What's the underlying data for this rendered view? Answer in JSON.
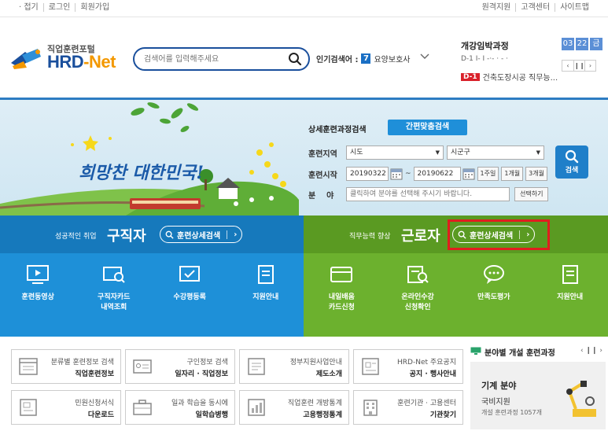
{
  "util": {
    "left": [
      "· 접기",
      "로그인",
      "회원가입"
    ],
    "right": [
      "원격지원",
      "고객센터",
      "사이트맵"
    ]
  },
  "logo": {
    "sub": "직업훈련포털",
    "main_a": "HRD",
    "main_b": "-Net"
  },
  "search": {
    "placeholder": "검색어를 입력해주세요"
  },
  "popular": {
    "label": "인기검색어 :",
    "rank": "7",
    "keyword": "요양보호사"
  },
  "course": {
    "title": "개강임박과정",
    "date": [
      "03",
      "22",
      "금"
    ],
    "line1": "D-1  I-   I -·-  ·  - ·",
    "tag": "D-1",
    "line2": "건축도장시공 직무능...",
    "controls": [
      "‹",
      "❙❙",
      "›"
    ]
  },
  "banner": {
    "slogan": "희망찬 대한민국!"
  },
  "dsearch": {
    "title": "상세훈련과정검색",
    "quick": "간편맞춤검색",
    "region_label": "훈련지역",
    "region_sido": "시도",
    "region_sigungu": "시군구",
    "start_label": "훈련시작",
    "start_from": "20190322",
    "tilde": "~",
    "start_to": "20190622",
    "periods": [
      "1주일",
      "1개월",
      "3개월"
    ],
    "field_label": "분    야",
    "field_placeholder": "클릭하여 분야를 선택해 주시기 바랍니다.",
    "field_button": "선택하기",
    "search_button": "검색"
  },
  "seeker": {
    "small": "성공적인 취업",
    "big": "구직자",
    "pill": "훈련상세검색",
    "items": [
      "훈련동영상",
      "구직자카드\n내역조회",
      "수강평등록",
      "지원안내"
    ]
  },
  "worker": {
    "small": "직무능력 향상",
    "big": "근로자",
    "pill": "훈련상세검색",
    "items": [
      "내일배움\n카드신청",
      "온라인수강\n신청확인",
      "만족도평가",
      "지원안내"
    ]
  },
  "cards": [
    {
      "l1": "분류별 훈련정보 검색",
      "l2": "직업훈련정보"
    },
    {
      "l1": "구인정보 검색",
      "l2": "일자리 · 직업정보"
    },
    {
      "l1": "정부지원사업안내",
      "l2": "제도소개"
    },
    {
      "l1": "HRD-Net 주요공지",
      "l2": "공지 · 행사안내"
    },
    {
      "l1": "민원신청서식",
      "l2": "다운로드"
    },
    {
      "l1": "일과 학습을 동시에",
      "l2": "일학습병행"
    },
    {
      "l1": "직업훈련 개방통계",
      "l2": "고용행정통계"
    },
    {
      "l1": "훈련기관 · 고용센터",
      "l2": "기관찾기"
    }
  ],
  "field": {
    "title": "분야별 개설 훈련과정",
    "nav": "‹ ❙❙ ›",
    "f1": "기계 분야",
    "f2": "국비지원",
    "f3": "개설 훈련과정 1057개"
  }
}
